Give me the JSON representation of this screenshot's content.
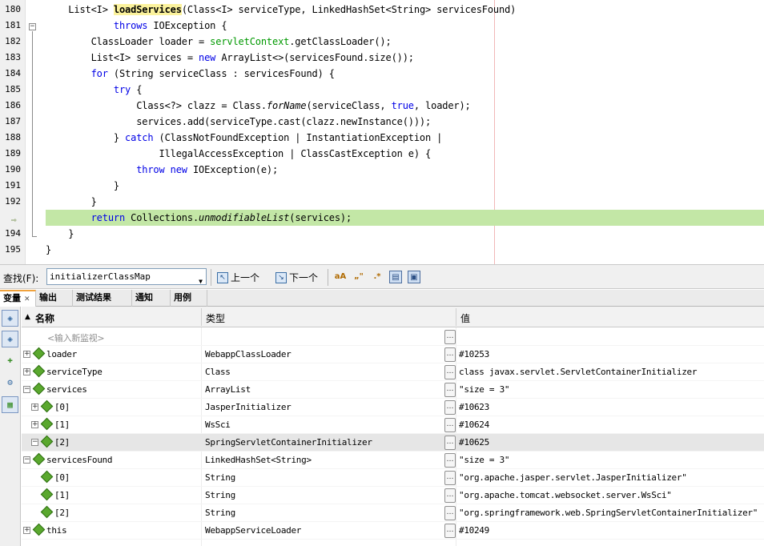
{
  "editor": {
    "lines": [
      {
        "n": "180",
        "html": "    List&lt;I&gt; <span class=\"bold-hl\">loadServices</span>(Class&lt;I&gt; serviceType, LinkedHashSet&lt;String&gt; servicesFound)"
      },
      {
        "n": "181",
        "html": "            <span class=\"kw\">throws</span> IOException {"
      },
      {
        "n": "182",
        "html": "        ClassLoader loader = <span class=\"fld\">servletContext</span>.getClassLoader();"
      },
      {
        "n": "183",
        "html": "        List&lt;I&gt; services = <span class=\"kw\">new</span> ArrayList&lt;&gt;(servicesFound.size());"
      },
      {
        "n": "184",
        "html": "        <span class=\"kw\">for</span> (String serviceClass : servicesFound) {"
      },
      {
        "n": "185",
        "html": "            <span class=\"kw\">try</span> {"
      },
      {
        "n": "186",
        "html": "                Class&lt;?&gt; clazz = Class.<span class=\"meth\">forName</span>(serviceClass, <span class=\"kw\">true</span>, loader);"
      },
      {
        "n": "187",
        "html": "                services.add(serviceType.cast(clazz.newInstance()));"
      },
      {
        "n": "188",
        "html": "            } <span class=\"kw\">catch</span> (ClassNotFoundException | InstantiationException |"
      },
      {
        "n": "189",
        "html": "                    IllegalAccessException | ClassCastException e) {"
      },
      {
        "n": "190",
        "html": "                <span class=\"kw\">throw</span> <span class=\"kw\">new</span> IOException(e);"
      },
      {
        "n": "191",
        "html": "            }"
      },
      {
        "n": "192",
        "html": "        }"
      },
      {
        "n": "",
        "html": "        <span class=\"kw\">return</span> Collections.<span class=\"meth\">unmodifiableList</span>(services);",
        "current": true
      },
      {
        "n": "194",
        "html": "    }"
      },
      {
        "n": "195",
        "html": "}"
      }
    ]
  },
  "findbar": {
    "label": "查找(F):",
    "query": "initializerClassMap",
    "prev_label": "上一个",
    "next_label": "下一个"
  },
  "tabs": [
    "变量",
    "输出",
    "测试结果",
    "通知",
    "用例"
  ],
  "vars": {
    "headers": {
      "name": "名称",
      "type": "类型",
      "value": "值"
    },
    "placeholder": "<输入新监视>",
    "rows": [
      {
        "indent": 0,
        "exp": "+",
        "name": "loader",
        "type": "WebappClassLoader",
        "value": "#10253"
      },
      {
        "indent": 0,
        "exp": "+",
        "name": "serviceType",
        "type": "Class",
        "value": "class javax.servlet.ServletContainerInitializer"
      },
      {
        "indent": 0,
        "exp": "−",
        "name": "services",
        "type": "ArrayList",
        "value": "\"size = 3\""
      },
      {
        "indent": 1,
        "exp": "+",
        "name": "[0]",
        "type": "JasperInitializer",
        "value": "#10623"
      },
      {
        "indent": 1,
        "exp": "+",
        "name": "[1]",
        "type": "WsSci",
        "value": "#10624"
      },
      {
        "indent": 1,
        "exp": "−",
        "name": "[2]",
        "type": "SpringServletContainerInitializer",
        "value": "#10625",
        "selected": true
      },
      {
        "indent": 0,
        "exp": "−",
        "name": "servicesFound",
        "type": "LinkedHashSet<String>",
        "value": "\"size = 3\""
      },
      {
        "indent": 1,
        "exp": "",
        "name": "[0]",
        "type": "String",
        "value": "\"org.apache.jasper.servlet.JasperInitializer\""
      },
      {
        "indent": 1,
        "exp": "",
        "name": "[1]",
        "type": "String",
        "value": "\"org.apache.tomcat.websocket.server.WsSci\""
      },
      {
        "indent": 1,
        "exp": "",
        "name": "[2]",
        "type": "String",
        "value": "\"org.springframework.web.SpringServletContainerInitializer\""
      },
      {
        "indent": 0,
        "exp": "+",
        "name": "this",
        "type": "WebappServiceLoader",
        "value": "#10249"
      }
    ]
  }
}
